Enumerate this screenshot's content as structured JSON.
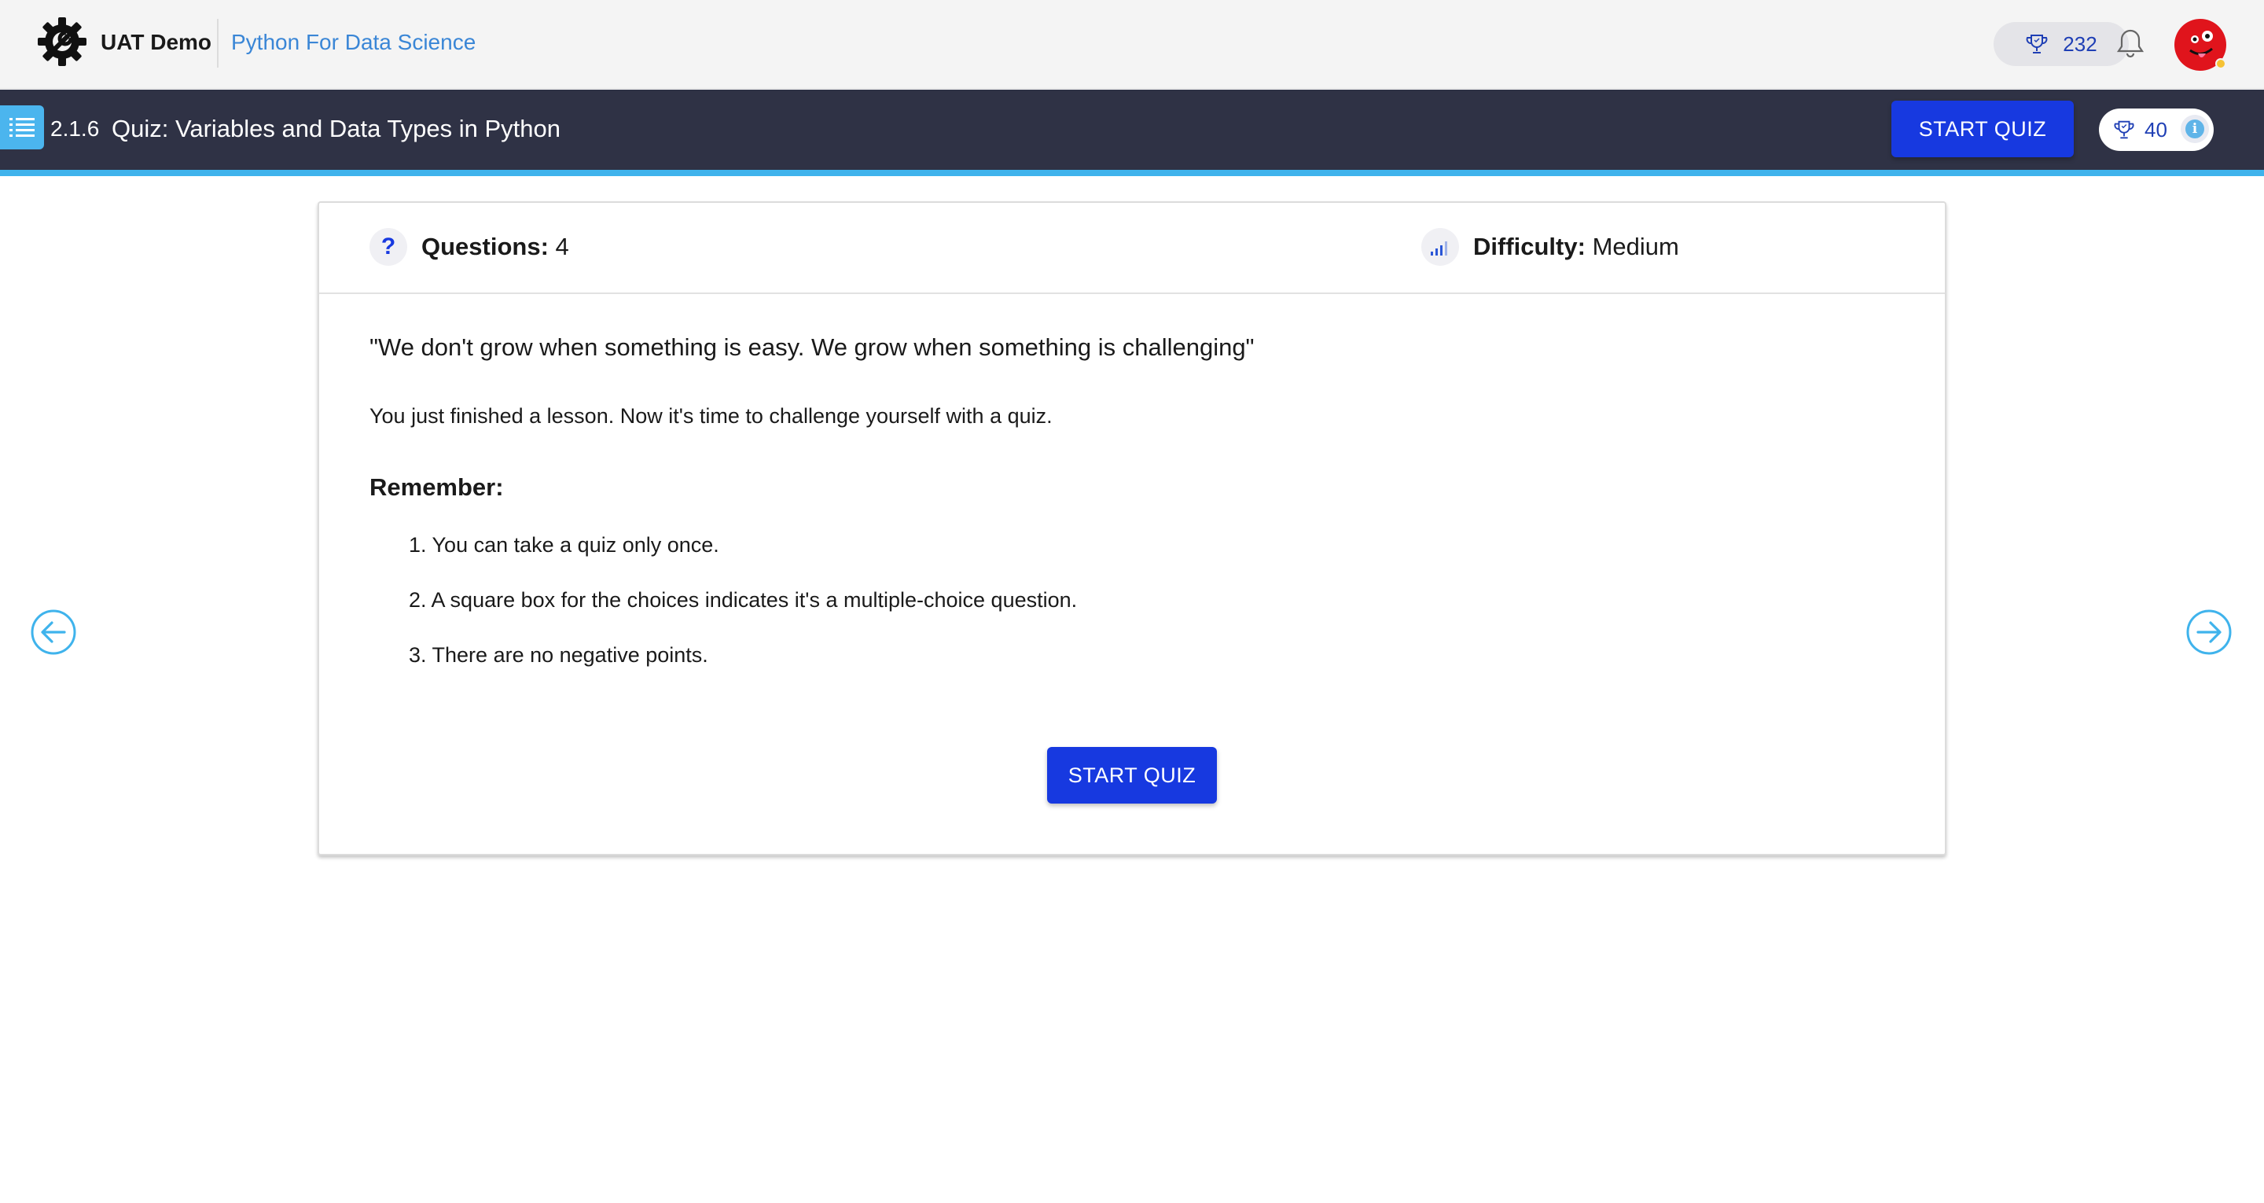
{
  "header": {
    "brand_name": "UAT Demo",
    "course_title": "Python For Data Science",
    "points": "232",
    "icons": [
      "gear-logo-icon",
      "trophy-icon",
      "bell-icon",
      "avatar"
    ]
  },
  "lesson": {
    "number": "2.1.6",
    "title": "Quiz: Variables and Data Types in Python",
    "start_label": "START QUIZ",
    "reward_points": "40",
    "info_glyph": "i"
  },
  "quiz": {
    "questions_label": "Questions:",
    "questions_value": "4",
    "difficulty_label": "Difficulty:",
    "difficulty_value": "Medium",
    "question_glyph": "?",
    "quote": "\"We don't grow when something is easy. We grow when something is challenging\"",
    "intro": "You just finished a lesson. Now it's time to challenge yourself with a quiz.",
    "remember_heading": "Remember:",
    "rules": [
      "1. You can take a quiz only once.",
      "2. A square box for the choices indicates it's a multiple-choice question.",
      "3. There are no negative points."
    ],
    "start_label": "START QUIZ"
  },
  "colors": {
    "primary_button": "#1739e0",
    "lesson_bar": "#2f3245",
    "accent": "#3fb3ec",
    "link": "#3a86d6",
    "avatar": "#e0141c"
  }
}
